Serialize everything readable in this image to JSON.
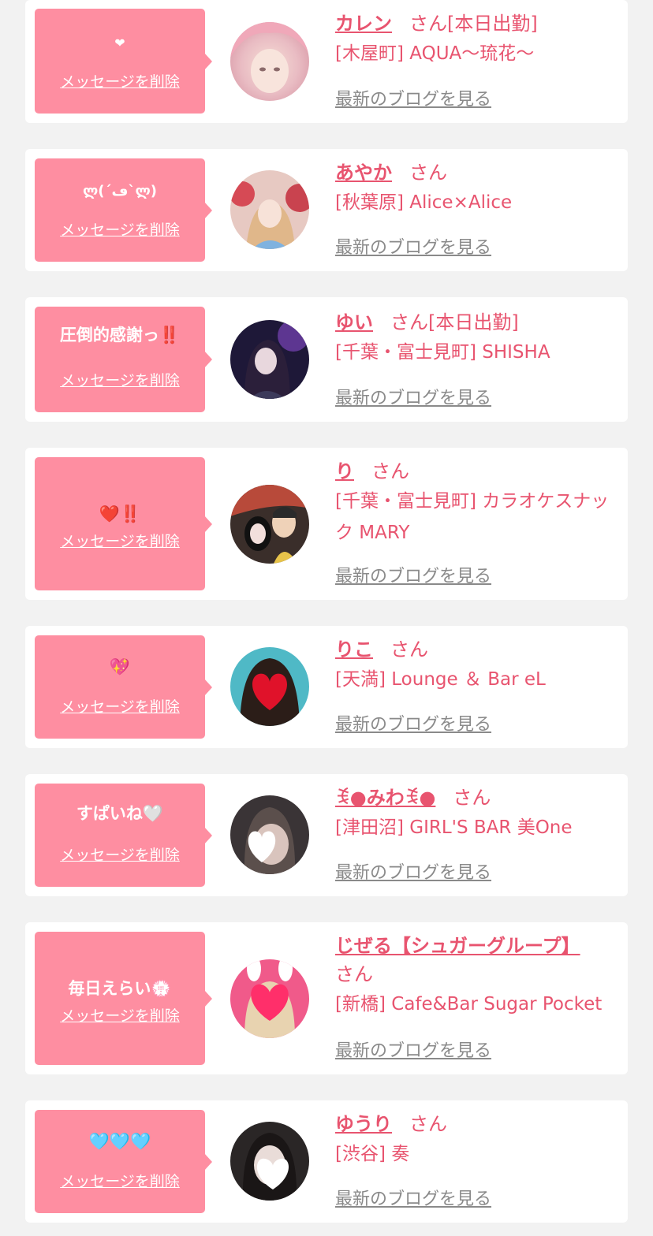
{
  "delete_label": "メッセージを削除",
  "blog_label": "最新のブログを見る",
  "san_label": "さん",
  "colors": {
    "bubble": "#fe8ea1",
    "accent": "#e8546f",
    "link_gray": "#8a8a8a",
    "card": "#ffffff",
    "page_bg": "#f2f2f2"
  },
  "entries": [
    {
      "message": "❤",
      "name": "カレン",
      "status": "[本日出勤]",
      "shop": "[木屋町] AQUA〜琉花〜"
    },
    {
      "message": "ლ(´ڡ`ლ)",
      "name": "あやか",
      "status": "",
      "shop": "[秋葉原] Alice×Alice"
    },
    {
      "message": "圧倒的感謝っ‼️",
      "name": "ゆい",
      "status": "[本日出勤]",
      "shop": "[千葉・富士見町] SHISHA"
    },
    {
      "message": "❤️‼️",
      "name": "り",
      "status": "",
      "shop": "[千葉・富士見町] カラオケスナック MARY"
    },
    {
      "message": "💖",
      "name": "りこ",
      "status": "",
      "shop": "[天満] Lounge ＆ Bar eL"
    },
    {
      "message": "すぱいね🤍",
      "name": "ꉂ●みわꉂ●",
      "status": "",
      "shop": "[津田沼] GIRL'S BAR 美One"
    },
    {
      "message": "毎日えらい💮",
      "name": "じぜる【シュガーグループ】",
      "status": "",
      "shop": "[新橋] Cafe&Bar Sugar Pocket"
    },
    {
      "message": "🩵🩵🩵",
      "name": "ゆうり",
      "status": "",
      "shop": "[渋谷] 奏"
    }
  ]
}
